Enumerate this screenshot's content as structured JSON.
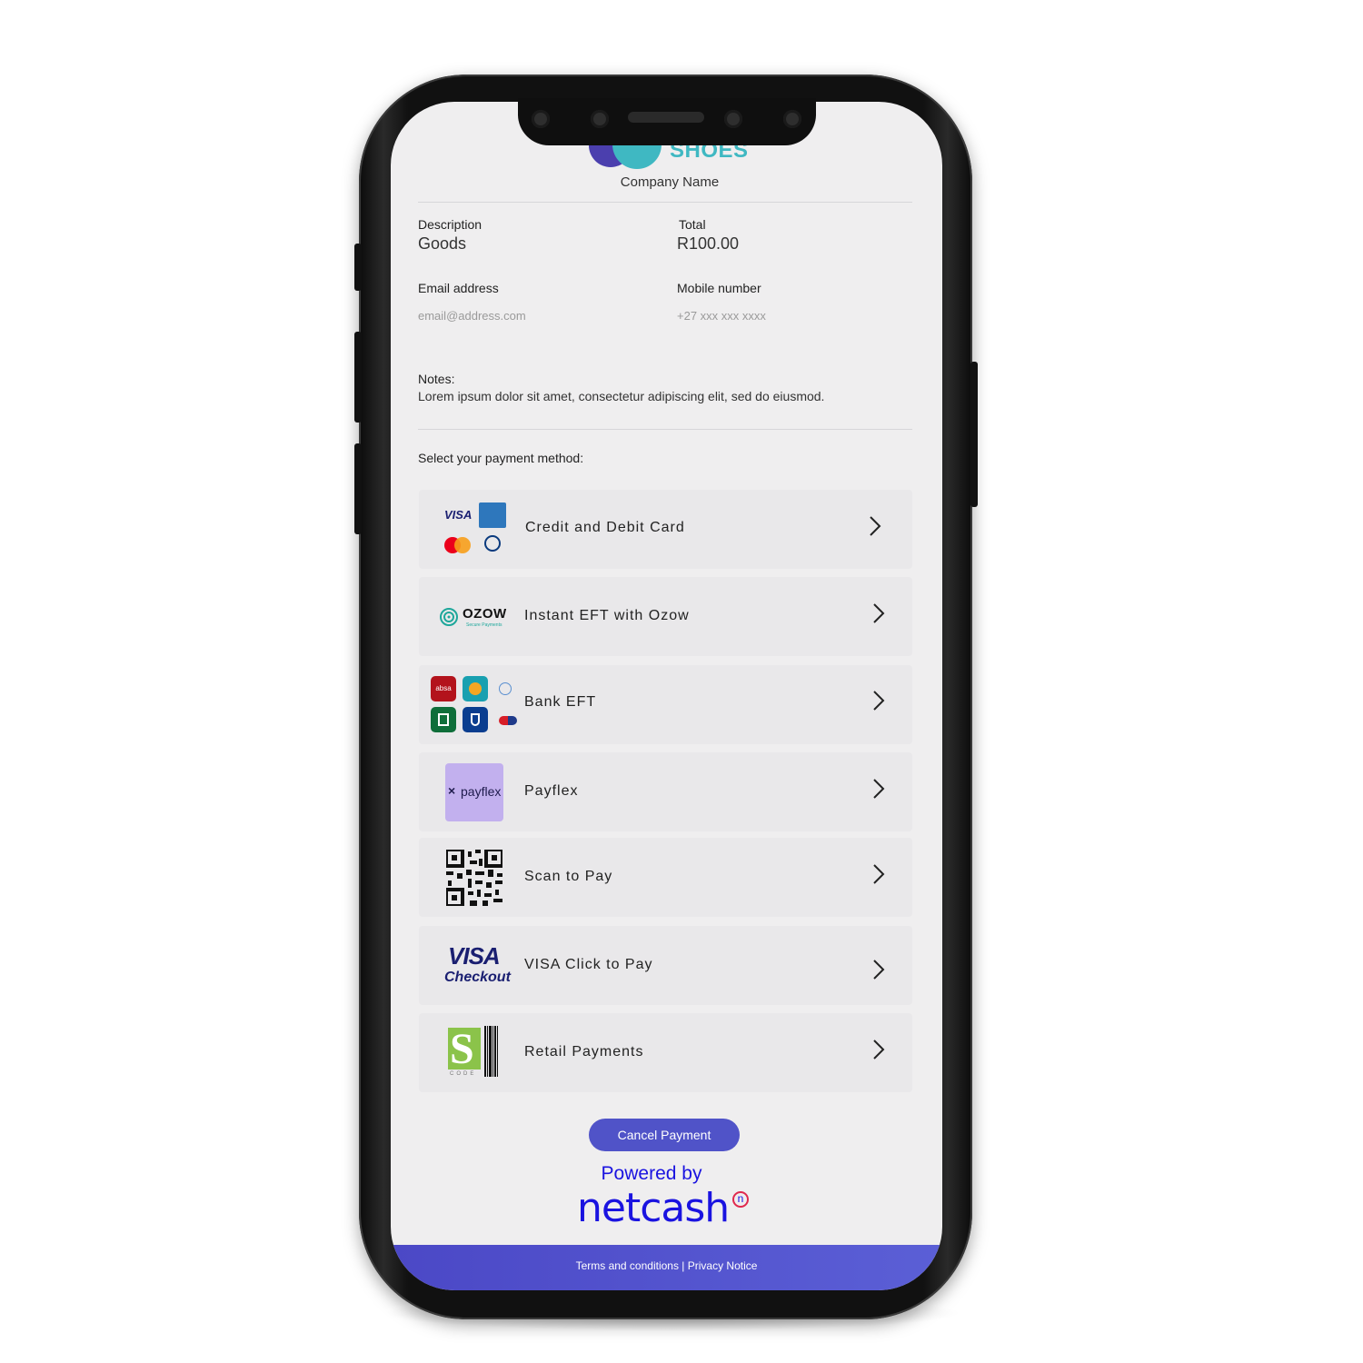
{
  "header": {
    "brand_text": "SHOES",
    "company_name": "Company Name"
  },
  "details": {
    "description_label": "Description",
    "description_value": "Goods",
    "total_label": "Total",
    "total_value": "R100.00",
    "email_label": "Email address",
    "email_placeholder": "email@address.com",
    "mobile_label": "Mobile number",
    "mobile_placeholder": "+27 xxx xxx xxxx",
    "notes_label": "Notes:",
    "notes_text": "Lorem ipsum dolor sit amet, consectetur adipiscing elit, sed do eiusmod."
  },
  "payment": {
    "select_label": "Select your payment method:",
    "methods": [
      {
        "label": "Credit and Debit Card",
        "icon": "card-brands-icon"
      },
      {
        "label": "Instant EFT with Ozow",
        "icon": "ozow-logo-icon"
      },
      {
        "label": "Bank EFT",
        "icon": "bank-logos-icon"
      },
      {
        "label": "Payflex",
        "icon": "payflex-logo-icon"
      },
      {
        "label": "Scan to Pay",
        "icon": "qr-code-icon"
      },
      {
        "label": "VISA Click to Pay",
        "icon": "visa-checkout-icon"
      },
      {
        "label": "Retail Payments",
        "icon": "scode-barcode-icon"
      }
    ]
  },
  "logos": {
    "visa": "VISA",
    "amex": "AMERICAN EXPRESS",
    "mastercard": "mastercard",
    "diners": "Diners Club",
    "ozow": "OZOW",
    "ozow_sub": "Secure Payments",
    "absa": "absa",
    "payflex": "payflex",
    "visa_checkout_1": "VISA",
    "visa_checkout_2": "Checkout",
    "scode": "S",
    "scode_sub": "CODE"
  },
  "actions": {
    "cancel_label": "Cancel Payment"
  },
  "branding": {
    "powered_by": "Powered by",
    "netcash": "netcash",
    "netcash_mark": "n"
  },
  "footer": {
    "links": "Terms and conditions | Privacy Notice"
  },
  "colors": {
    "accent": "#5053c8",
    "netcash_blue": "#1a13e0",
    "brand_teal": "#3fb8c2",
    "screen_bg": "#efeeef",
    "row_bg": "#e9e8ea"
  }
}
